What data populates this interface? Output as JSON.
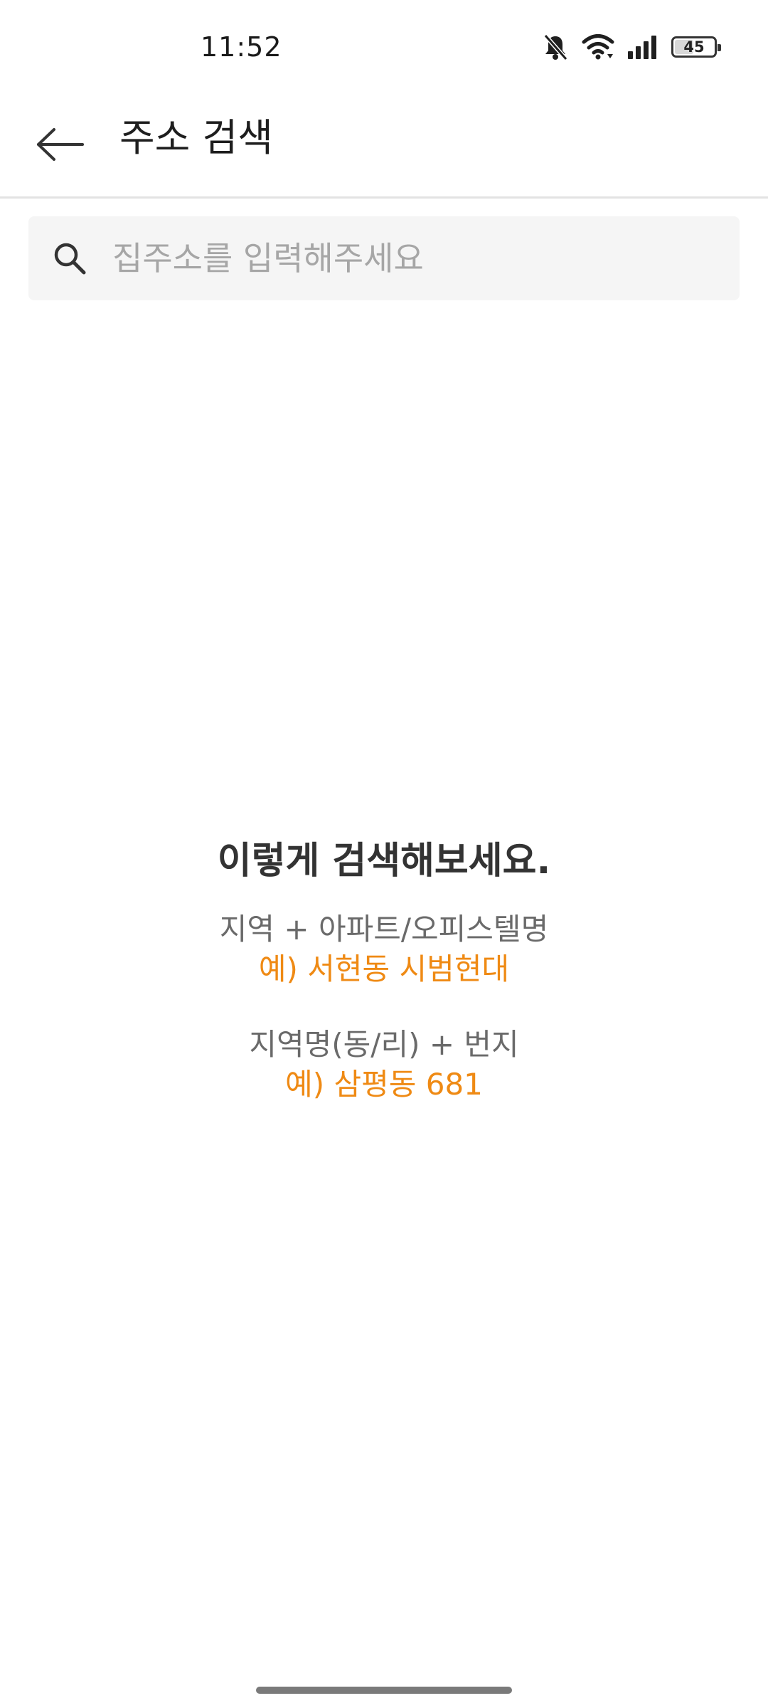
{
  "status_bar": {
    "time": "11:52",
    "battery_level": "45",
    "icons": [
      "bell-muted-icon",
      "wifi-icon",
      "signal-icon",
      "battery-icon"
    ]
  },
  "app_bar": {
    "back_icon": "arrow-left-icon",
    "title": "주소 검색"
  },
  "search": {
    "icon": "search-icon",
    "placeholder": "집주소를 입력해주세요",
    "value": ""
  },
  "guide": {
    "heading": "이렇게 검색해보세요.",
    "groups": [
      {
        "label": "지역 + 아파트/오피스텔명",
        "example": "예) 서현동 시범현대"
      },
      {
        "label": "지역명(동/리) + 번지",
        "example": "예) 삼평동 681"
      }
    ]
  },
  "colors": {
    "accent": "#ef8a14",
    "text_primary": "#333333",
    "text_secondary": "#6a6a6a",
    "placeholder": "#a6a6a6",
    "search_bg": "#f5f5f5"
  }
}
